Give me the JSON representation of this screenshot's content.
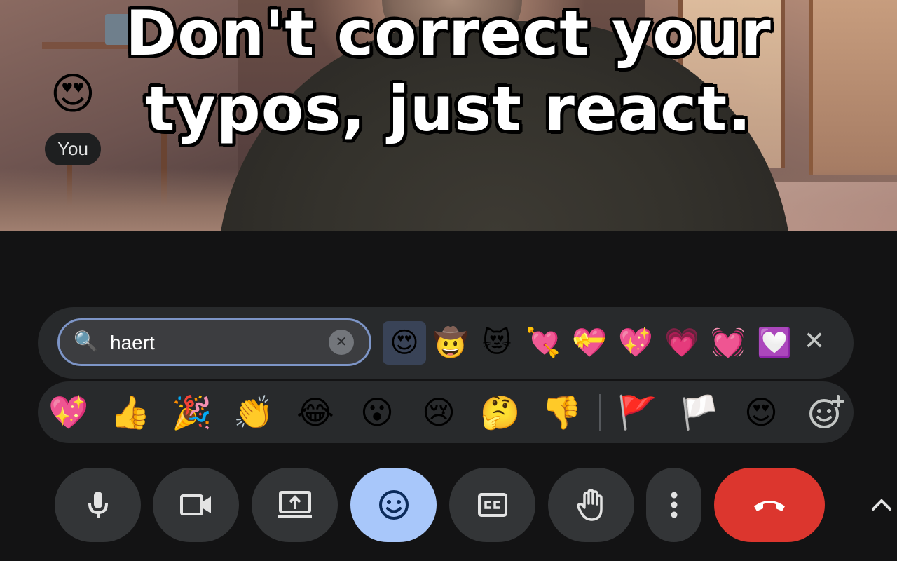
{
  "video": {
    "caption_line1": "Don't correct your",
    "caption_line2": "typos, just react.",
    "reaction": {
      "emoji": "😍",
      "name": "You"
    }
  },
  "emoji_search": {
    "search_icon": "magnifier-icon",
    "search_icon_glyph": "🔍",
    "query": "haert",
    "clear_glyph": "✕",
    "results": [
      "😍",
      "🤠",
      "😻",
      "💘",
      "💝",
      "💖",
      "💗",
      "💓",
      "💟"
    ],
    "selected_index": 0,
    "close_glyph": "✕"
  },
  "quick_reactions": {
    "items": [
      "💖",
      "👍",
      "🎉",
      "👏",
      "😂",
      "😮",
      "😢",
      "🤔",
      "👎"
    ],
    "after_divider": [
      "🚩",
      "🏳️",
      "😍"
    ],
    "add_icon": "add-reaction-icon"
  },
  "controls": {
    "buttons": [
      {
        "name": "microphone",
        "icon": "mic-icon"
      },
      {
        "name": "camera",
        "icon": "video-camera-icon"
      },
      {
        "name": "present",
        "icon": "present-screen-icon"
      },
      {
        "name": "reactions",
        "icon": "smiley-icon",
        "active": true
      },
      {
        "name": "captions",
        "icon": "closed-captions-icon"
      },
      {
        "name": "raise-hand",
        "icon": "hand-icon"
      },
      {
        "name": "more-options",
        "icon": "more-vert-icon"
      },
      {
        "name": "leave-call",
        "icon": "hang-up-icon"
      }
    ],
    "accent_color": "#a8c7fa",
    "hangup_color": "#dc362e",
    "expand_icon": "chevron-up-icon"
  }
}
